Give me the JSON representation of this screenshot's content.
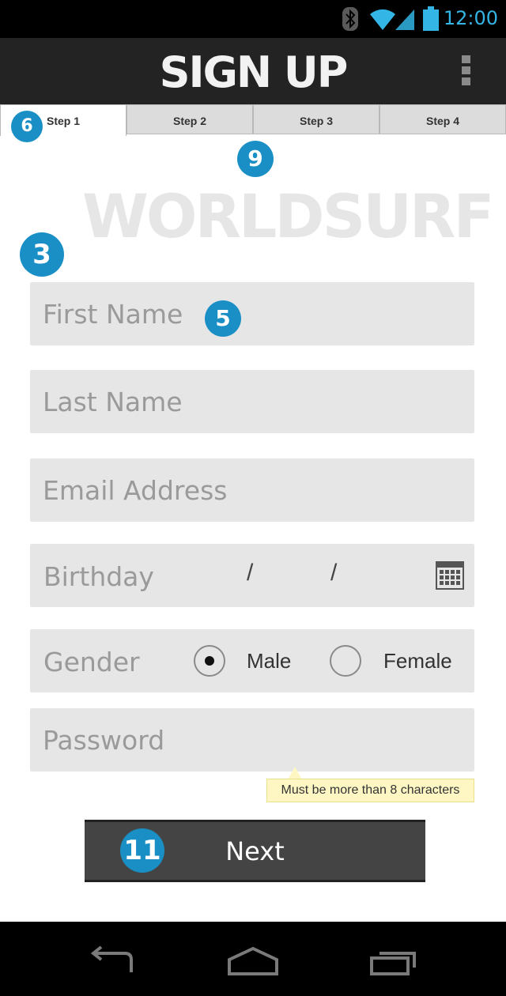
{
  "status_bar": {
    "time": "12:00",
    "icons": [
      "bluetooth-icon",
      "wifi-icon",
      "signal-icon",
      "battery-icon"
    ],
    "accent_color": "#33b5e5"
  },
  "action_bar": {
    "title": "SIGN UP",
    "menu_icon": "overflow-menu-icon"
  },
  "tabs": [
    {
      "label": "Step 1",
      "active": true
    },
    {
      "label": "Step 2",
      "active": false
    },
    {
      "label": "Step 3",
      "active": false
    },
    {
      "label": "Step 4",
      "active": false
    }
  ],
  "badges": {
    "tab": "6",
    "logo": "9",
    "form": "3",
    "field": "5",
    "button": "11",
    "color": "#1a8fc6"
  },
  "logo": {
    "text": "WORLDSURF"
  },
  "form": {
    "first_name": {
      "placeholder": "First Name",
      "value": ""
    },
    "last_name": {
      "placeholder": "Last Name",
      "value": ""
    },
    "email": {
      "placeholder": "Email Address",
      "value": ""
    },
    "birthday": {
      "label": "Birthday",
      "separator": "/",
      "month": "",
      "day": "",
      "year": ""
    },
    "gender": {
      "label": "Gender",
      "options": [
        "Male",
        "Female"
      ],
      "selected": "Male"
    },
    "password": {
      "placeholder": "Password",
      "value": "",
      "hint": "Must be more than 8 characters"
    }
  },
  "next_button": {
    "label": "Next"
  },
  "nav_bar": {
    "icons": [
      "back-icon",
      "home-icon",
      "recent-apps-icon"
    ]
  }
}
